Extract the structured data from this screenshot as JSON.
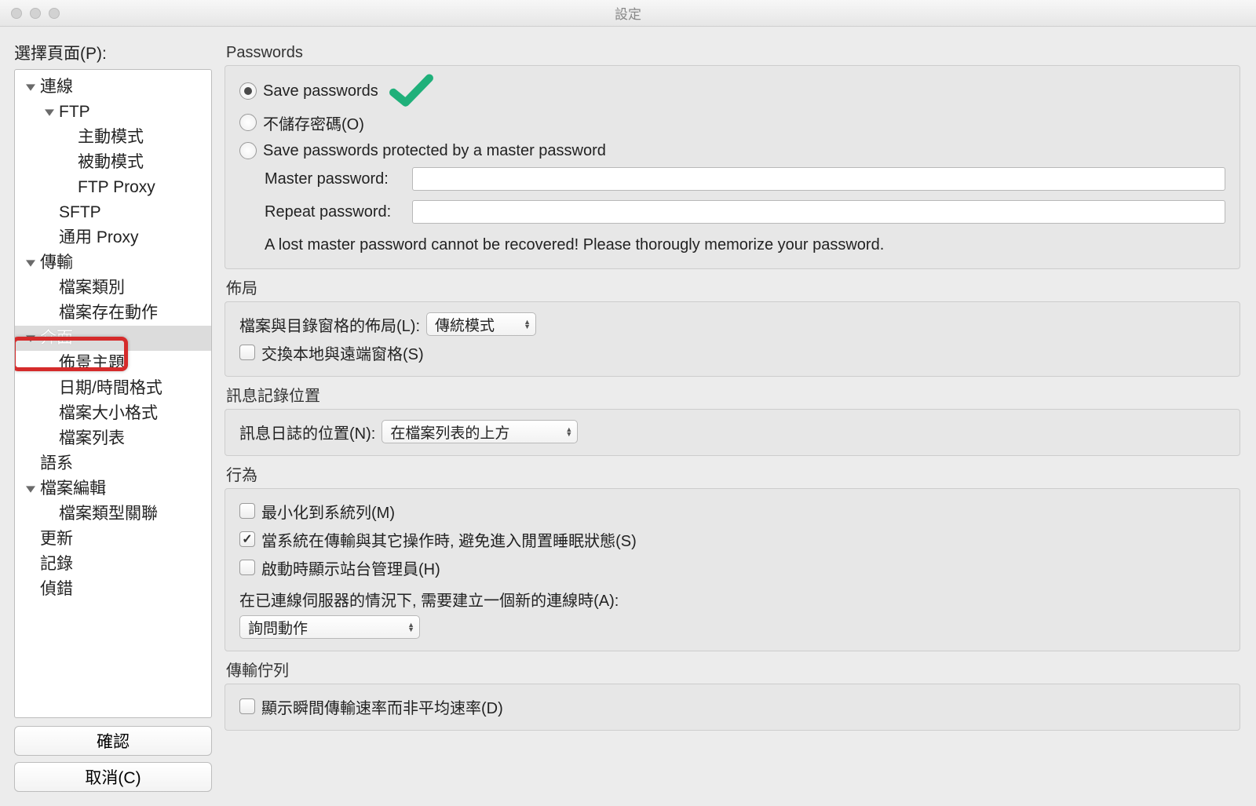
{
  "window": {
    "title": "設定"
  },
  "sidebar": {
    "label": "選擇頁面(P):",
    "ok": "確認",
    "cancel": "取消(C)",
    "tree": {
      "connection": "連線",
      "ftp": "FTP",
      "active": "主動模式",
      "passive": "被動模式",
      "ftp_proxy": "FTP Proxy",
      "sftp": "SFTP",
      "generic_proxy": "通用 Proxy",
      "transfer": "傳輸",
      "file_types": "檔案類別",
      "file_exists": "檔案存在動作",
      "interface": "介面",
      "themes": "佈景主題",
      "datetime": "日期/時間格式",
      "filesize": "檔案大小格式",
      "filelist": "檔案列表",
      "language": "語系",
      "file_editing": "檔案編輯",
      "file_assoc": "檔案類型關聯",
      "update": "更新",
      "logging": "記錄",
      "debug": "偵錯"
    }
  },
  "passwords": {
    "title": "Passwords",
    "save": "Save passwords",
    "dont_save": "不儲存密碼(O)",
    "master": "Save passwords protected by a master password",
    "master_label": "Master password:",
    "repeat_label": "Repeat password:",
    "warn": "A lost master password cannot be recovered! Please thorougly memorize your password."
  },
  "layout": {
    "title": "佈局",
    "pane_label": "檔案與目錄窗格的佈局(L):",
    "pane_value": "傳統模式",
    "swap": "交換本地與遠端窗格(S)"
  },
  "msglog": {
    "title": "訊息記錄位置",
    "pos_label": "訊息日誌的位置(N):",
    "pos_value": "在檔案列表的上方"
  },
  "behavior": {
    "title": "行為",
    "min_tray": "最小化到系統列(M)",
    "prevent_sleep": "當系統在傳輸與其它操作時, 避免進入閒置睡眠狀態(S)",
    "show_sitemgr": "啟動時顯示站台管理員(H)",
    "new_conn_label": "在已連線伺服器的情況下, 需要建立一個新的連線時(A):",
    "new_conn_value": "詢問動作"
  },
  "queue": {
    "title": "傳輸佇列",
    "momentary": "顯示瞬間傳輸速率而非平均速率(D)"
  }
}
